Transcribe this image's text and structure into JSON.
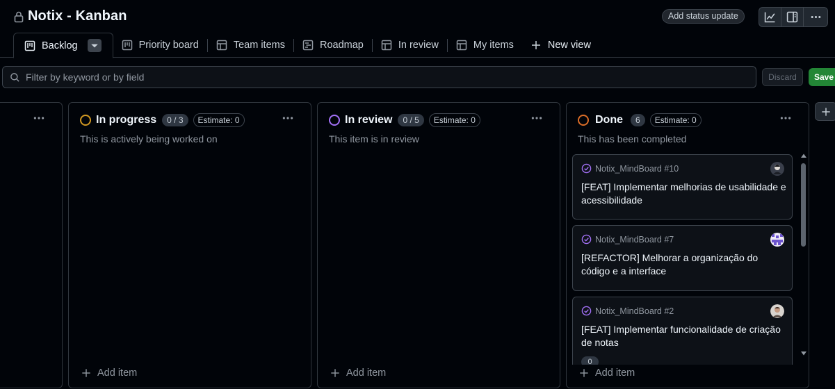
{
  "project": {
    "title": "Notix - Kanban"
  },
  "header": {
    "status_update_label": "Add status update",
    "actions": [
      "insights-icon",
      "layout-icon",
      "more-icon"
    ]
  },
  "tabs": [
    {
      "label": "Backlog",
      "icon": "board-icon",
      "active": true
    },
    {
      "label": "Priority board",
      "icon": "board-icon"
    },
    {
      "label": "Team items",
      "icon": "table-icon"
    },
    {
      "label": "Roadmap",
      "icon": "roadmap-icon"
    },
    {
      "label": "In review",
      "icon": "table-icon"
    },
    {
      "label": "My items",
      "icon": "table-icon"
    }
  ],
  "new_view_label": "New view",
  "filter": {
    "placeholder": "Filter by keyword or by field"
  },
  "discard_label": "Discard",
  "save_label": "Save",
  "columns": [
    {
      "name": "",
      "add_item": "Add item"
    },
    {
      "name": "In progress",
      "count": "0 / 3",
      "estimate": "Estimate: 0",
      "description": "This is actively being worked on",
      "color": "#d29922",
      "add_item": "Add item"
    },
    {
      "name": "In review",
      "count": "0 / 5",
      "estimate": "Estimate: 0",
      "description": "This item is in review",
      "color": "#a371f7",
      "add_item": "Add item"
    },
    {
      "name": "Done",
      "count": "6",
      "estimate": "Estimate: 0",
      "description": "This has been completed",
      "color": "#db6d28",
      "add_item": "Add item"
    }
  ],
  "cards": [
    {
      "repo": "Notix_MindBoard #10",
      "title": "[FEAT] Implementar melhorias de usabilidade e acessibilidade",
      "status_icon": "issue-closed-icon"
    },
    {
      "repo": "Notix_MindBoard #7",
      "title": "[REFACTOR] Melhorar a organização do código e a interface",
      "status_icon": "issue-closed-icon"
    },
    {
      "repo": "Notix_MindBoard #2",
      "title": "[FEAT] Implementar funcionalidade de criação de notas",
      "status_icon": "issue-closed-icon",
      "sub_count": "0"
    }
  ],
  "colors": {
    "accent_done": "#a371f7",
    "save_green": "#238636"
  }
}
